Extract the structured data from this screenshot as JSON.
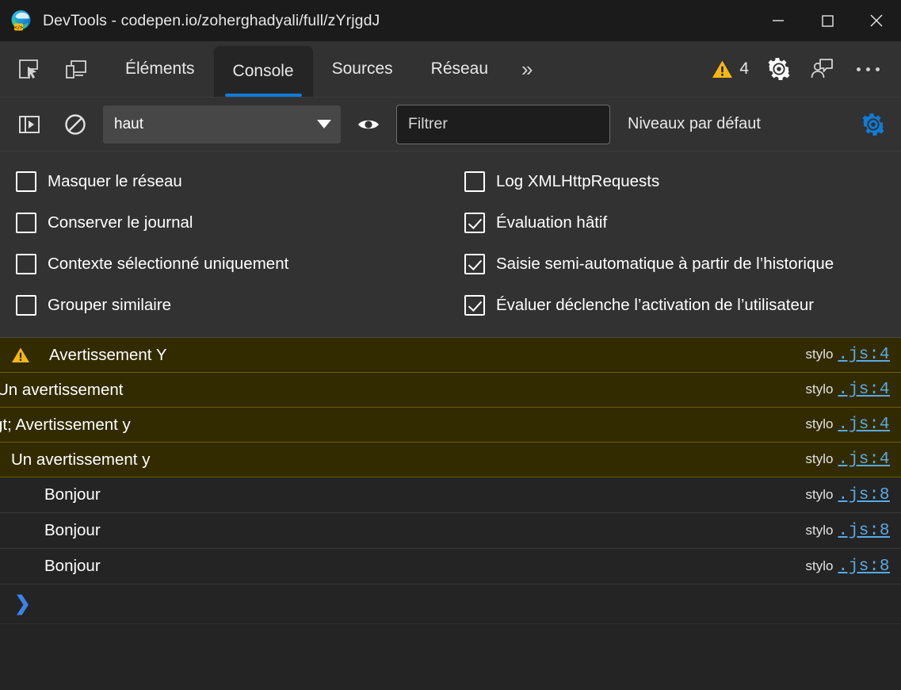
{
  "window": {
    "title": "DevTools - codepen.io/zoherghadyali/full/zYrjgdJ",
    "logo_icon": "edge-devtools-logo-icon",
    "controls": {
      "minimize": "minimize-icon",
      "maximize": "maximize-icon",
      "close": "close-icon"
    }
  },
  "tabbar": {
    "inspect_icon": "inspect-element-icon",
    "device_icon": "device-emulation-icon",
    "tabs": [
      {
        "label": "Éléments",
        "active": false
      },
      {
        "label": "Console",
        "active": true
      },
      {
        "label": "Sources",
        "active": false
      },
      {
        "label": "Réseau",
        "active": false
      }
    ],
    "more_tabs_label": "»",
    "warning_icon": "warning-triangle-icon",
    "warning_count": "4",
    "settings_icon": "gear-icon",
    "feedback_icon": "feedback-person-icon",
    "more_options_icon": "more-options-icon",
    "accent_color": "#0f7bd6"
  },
  "filterbar": {
    "sidebar_toggle_icon": "console-sidebar-toggle-icon",
    "clear_console_icon": "clear-console-icon",
    "context_value": "haut",
    "context_caret_icon": "chevron-down-icon",
    "eye_icon": "live-expression-eye-icon",
    "filter_placeholder": "Filtrer",
    "filter_value": "",
    "levels_label": "Niveaux par défaut",
    "console_settings_icon": "gear-icon",
    "settings_gear_color": "#0f7bd6"
  },
  "settings": {
    "left": [
      {
        "label": "Masquer le réseau",
        "checked": false
      },
      {
        "label": "Conserver le journal",
        "checked": false
      },
      {
        "label": "Contexte sélectionné uniquement",
        "checked": false
      },
      {
        "label": "Grouper similaire",
        "checked": false
      }
    ],
    "right": [
      {
        "label": "Log XMLHttpRequests",
        "checked": false
      },
      {
        "label": "Évaluation hâtif",
        "checked": true
      },
      {
        "label": "Saisie semi-automatique à partir de l’historique",
        "checked": true
      },
      {
        "label": "Évaluer déclenche l’activation de l’utilisateur",
        "checked": true
      }
    ]
  },
  "console": {
    "messages": [
      {
        "level": "warning",
        "icon": "warning-triangle-icon",
        "text": "Avertissement Y",
        "indent": 14,
        "source_name": "stylo",
        "source_link": ".js:4"
      },
      {
        "level": "warning",
        "icon": "",
        "text": "Un avertissement",
        "indent": -4,
        "source_name": "stylo",
        "source_link": ".js:4"
      },
      {
        "level": "warning",
        "icon": "",
        "text": "gt; Avertissement y",
        "indent": -8,
        "source_name": "stylo",
        "source_link": ".js:4"
      },
      {
        "level": "warning",
        "icon": "",
        "text": "Un avertissement y",
        "indent": 14,
        "source_name": "stylo",
        "source_link": ".js:4"
      },
      {
        "level": "log",
        "icon": "",
        "text": "Bonjour",
        "indent": 56,
        "source_name": "stylo",
        "source_link": ".js:8"
      },
      {
        "level": "log",
        "icon": "",
        "text": "Bonjour",
        "indent": 56,
        "source_name": "stylo",
        "source_link": ".js:8"
      },
      {
        "level": "log",
        "icon": "",
        "text": "Bonjour",
        "indent": 56,
        "source_name": "stylo",
        "source_link": ".js:8"
      }
    ],
    "prompt_icon": "prompt-chevron-icon",
    "prompt_value": "",
    "warning_bg": "#332b00",
    "warning_border": "#6b5e00",
    "link_color": "#5aa9e6"
  }
}
